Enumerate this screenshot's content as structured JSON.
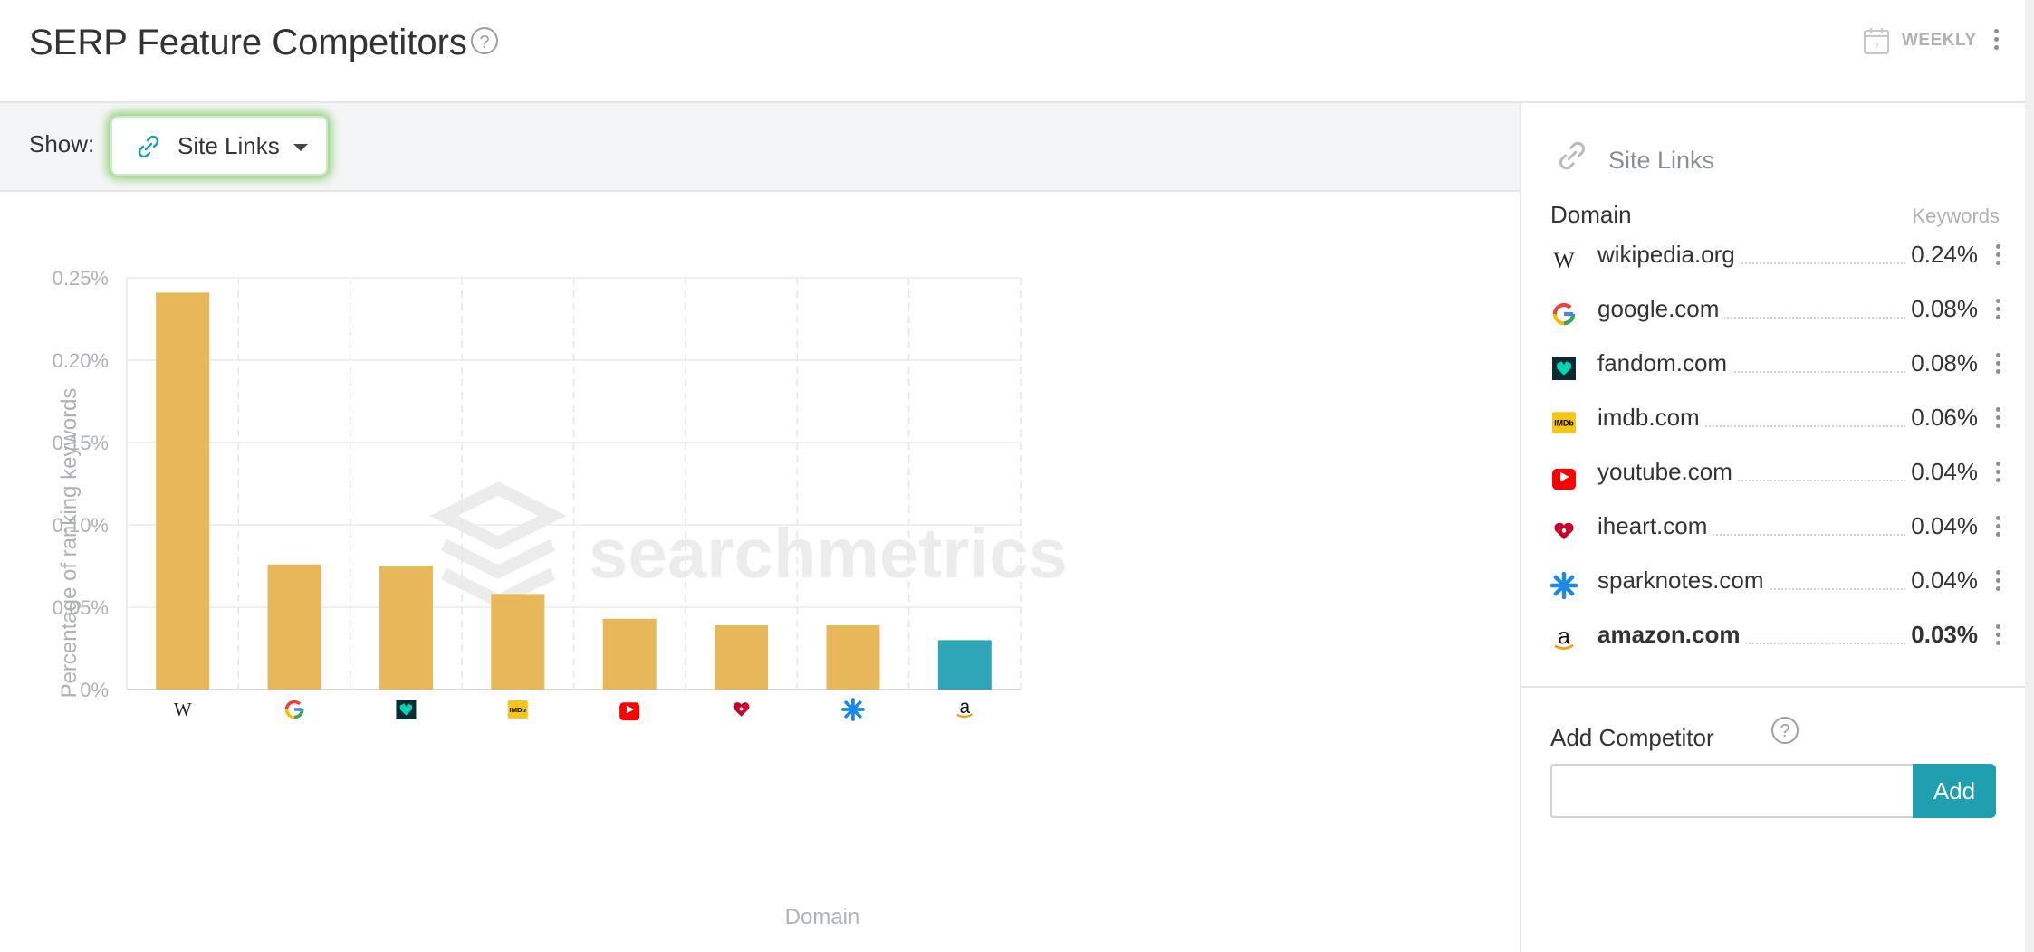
{
  "header": {
    "title": "SERP Feature Competitors",
    "help": "?",
    "period": "WEEKLY",
    "calendar_day": "7"
  },
  "filter": {
    "show_label": "Show:",
    "selected_feature": "Site Links"
  },
  "chart_data": {
    "type": "bar",
    "categories": [
      "wikipedia.org",
      "google.com",
      "fandom.com",
      "imdb.com",
      "youtube.com",
      "iheart.com",
      "sparknotes.com",
      "amazon.com"
    ],
    "values": [
      0.241,
      0.076,
      0.075,
      0.058,
      0.043,
      0.039,
      0.039,
      0.03
    ],
    "ylim": [
      0,
      0.25
    ],
    "yticks": [
      0,
      0.05,
      0.1,
      0.15,
      0.2,
      0.25
    ],
    "ytick_labels": [
      "0%",
      "0.05%",
      "0.10%",
      "0.15%",
      "0.20%",
      "0.25%"
    ],
    "xlabel": "Domain",
    "ylabel": "Percentage of ranking keywords",
    "grid": true,
    "watermark": "searchmetrics",
    "colors": {
      "default": "#e6b85a",
      "highlight": "#2fa6b8"
    },
    "highlighted_category": "amazon.com"
  },
  "sidebar": {
    "feature_title": "Site Links",
    "col_domain": "Domain",
    "col_keywords": "Keywords",
    "competitors": [
      {
        "domain": "wikipedia.org",
        "value": "0.24%",
        "icon": "wikipedia-icon",
        "bold": false
      },
      {
        "domain": "google.com",
        "value": "0.08%",
        "icon": "google-icon",
        "bold": false
      },
      {
        "domain": "fandom.com",
        "value": "0.08%",
        "icon": "fandom-icon",
        "bold": false
      },
      {
        "domain": "imdb.com",
        "value": "0.06%",
        "icon": "imdb-icon",
        "bold": false
      },
      {
        "domain": "youtube.com",
        "value": "0.04%",
        "icon": "youtube-icon",
        "bold": false
      },
      {
        "domain": "iheart.com",
        "value": "0.04%",
        "icon": "iheart-icon",
        "bold": false
      },
      {
        "domain": "sparknotes.com",
        "value": "0.04%",
        "icon": "sparknotes-icon",
        "bold": false
      },
      {
        "domain": "amazon.com",
        "value": "0.03%",
        "icon": "amazon-icon",
        "bold": true
      }
    ],
    "add_label": "Add Competitor",
    "add_help": "?",
    "add_input_value": "",
    "add_button": "Add"
  }
}
